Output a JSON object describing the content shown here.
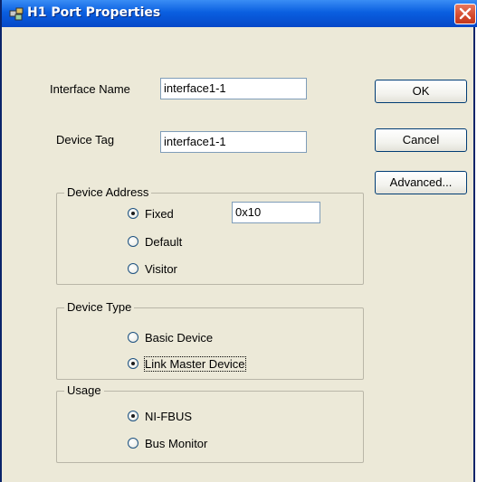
{
  "window": {
    "title": "H1 Port Properties"
  },
  "fields": {
    "interface_name_label": "Interface Name",
    "interface_name_value": "interface1-1",
    "device_tag_label": "Device Tag",
    "device_tag_value": "interface1-1"
  },
  "buttons": {
    "ok": "OK",
    "cancel": "Cancel",
    "advanced": "Advanced..."
  },
  "device_address": {
    "title": "Device Address",
    "options": [
      "Fixed",
      "Default",
      "Visitor"
    ],
    "selected": "Fixed",
    "fixed_value": "0x10"
  },
  "device_type": {
    "title": "Device Type",
    "options": [
      "Basic Device",
      "Link Master Device"
    ],
    "selected": "Link Master Device"
  },
  "usage": {
    "title": "Usage",
    "options": [
      "NI-FBUS",
      "Bus Monitor"
    ],
    "selected": "NI-FBUS"
  },
  "icons": {
    "title_icon": "network-ports-icon",
    "close": "close-icon"
  },
  "colors": {
    "titlebar": "#0a5fe0",
    "close_button": "#d44a2d",
    "dialog_background": "#ece9d8"
  }
}
